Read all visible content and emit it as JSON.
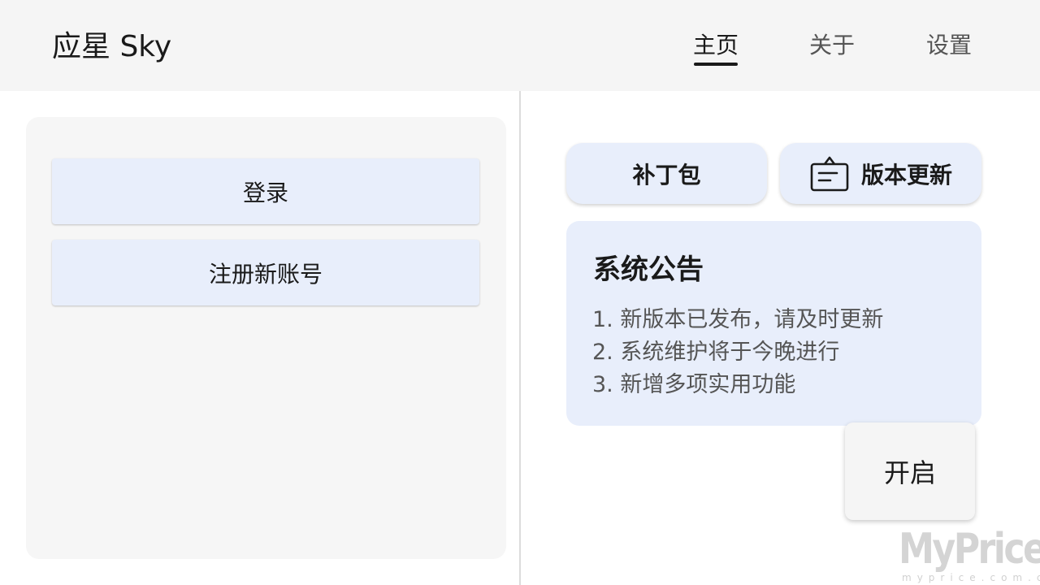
{
  "header": {
    "title": "应星 Sky",
    "tabs": [
      {
        "label": "主页",
        "active": true
      },
      {
        "label": "关于",
        "active": false
      },
      {
        "label": "设置",
        "active": false
      }
    ]
  },
  "left_panel": {
    "login_label": "登录",
    "register_label": "注册新账号"
  },
  "right_panel": {
    "patch_label": "补丁包",
    "update_label": "版本更新",
    "update_icon": "notice-board-icon",
    "notice": {
      "title": "系统公告",
      "items": [
        "1. 新版本已发布，请及时更新",
        "2. 系统维护将于今晚进行",
        "3. 新增多项实用功能"
      ]
    },
    "fab_label": "开启"
  },
  "watermark": {
    "main": "MyPrice",
    "sub": "myprice.com.cn"
  },
  "colors": {
    "header_bg": "#f5f5f5",
    "button_bg": "#e8eefb",
    "panel_bg": "#f6f6f6",
    "text_primary": "#1a1a1a",
    "text_secondary": "#555555"
  }
}
